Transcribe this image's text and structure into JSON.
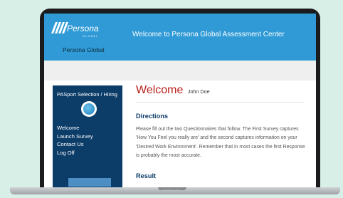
{
  "header": {
    "logo_text": "Persona",
    "logo_subtext": "GLOBAL",
    "company_name": "Persona Global",
    "banner": "Welcome to Persona Global Assessment Center"
  },
  "sidebar": {
    "title": "PASport Selection / Hiring",
    "items": [
      {
        "label": "Welcome"
      },
      {
        "label": "Launch Survey"
      },
      {
        "label": "Contact Us"
      },
      {
        "label": "Log Off"
      }
    ]
  },
  "content": {
    "welcome_word": "Welcome",
    "user_name": "John Doe",
    "directions_heading": "Directions",
    "directions_text": "Please fill out the two Questionnaires that follow. The First Survey captures 'How You Feel you really are' and the second captures information on your 'Desired Work Environment'. Remember that in most cases the first Response is probably the most accurate.",
    "result_heading": "Result"
  },
  "device": {
    "label": "MacBook Pro"
  },
  "colors": {
    "header_blue": "#2f9ad6",
    "sidebar_navy": "#0c3c68",
    "welcome_red": "#b8201a",
    "background_mint": "#d8efe8"
  }
}
